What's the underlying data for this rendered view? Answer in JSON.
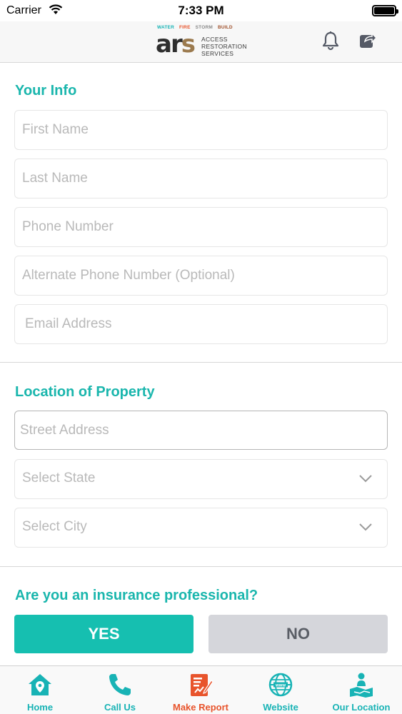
{
  "status_bar": {
    "carrier": "Carrier",
    "time": "7:33 PM"
  },
  "header": {
    "logo": {
      "tags": [
        "WATER",
        "FIRE",
        "STORM",
        "BUILD"
      ],
      "mark": [
        "a",
        "r",
        "s"
      ],
      "words": [
        "ACCESS",
        "RESTORATION",
        "SERVICES"
      ]
    },
    "icons": [
      "bell-icon",
      "share-icon"
    ]
  },
  "your_info": {
    "title": "Your Info",
    "fields": [
      {
        "placeholder": "First Name",
        "value": ""
      },
      {
        "placeholder": "Last Name",
        "value": ""
      },
      {
        "placeholder": "Phone Number",
        "value": ""
      },
      {
        "placeholder": "Alternate Phone Number (Optional)",
        "value": ""
      },
      {
        "placeholder": "Email Address",
        "value": ""
      }
    ]
  },
  "location": {
    "title": "Location of Property",
    "street": {
      "placeholder": "Street Address",
      "value": ""
    },
    "state": {
      "placeholder": "Select State"
    },
    "city": {
      "placeholder": "Select City"
    }
  },
  "insurance": {
    "question": "Are you an insurance professional?",
    "yes_label": "YES",
    "no_label": "NO",
    "selected": "YES"
  },
  "tabs": [
    {
      "label": "Home",
      "icon": "home-icon"
    },
    {
      "label": "Call Us",
      "icon": "phone-icon"
    },
    {
      "label": "Make Report",
      "icon": "report-icon",
      "selected": true
    },
    {
      "label": "Website",
      "icon": "globe-icon"
    },
    {
      "label": "Our Location",
      "icon": "location-icon"
    }
  ],
  "colors": {
    "accent": "#1ab6ad",
    "active_tab": "#e8542c",
    "yes_button": "#16bfb0",
    "no_button": "#d5d6db"
  }
}
